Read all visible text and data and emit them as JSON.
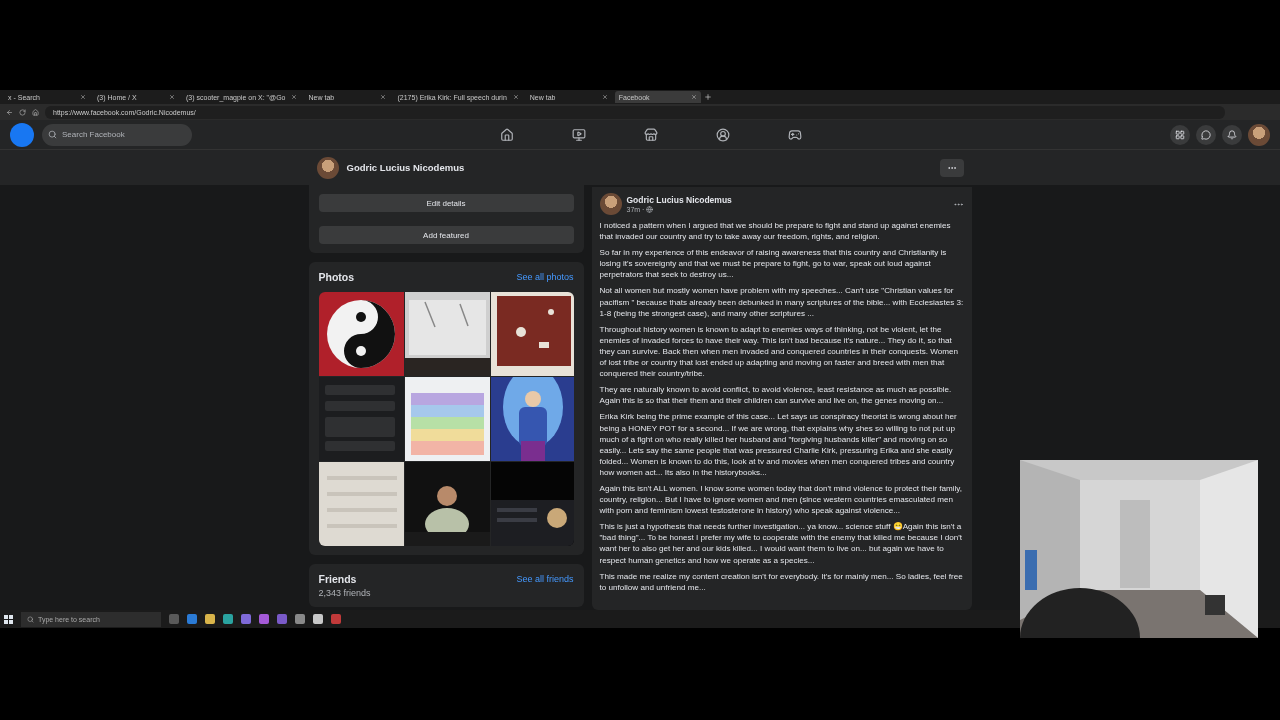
{
  "browser": {
    "tabs": [
      {
        "title": "x - Search",
        "selected": false
      },
      {
        "title": "(3) Home / X",
        "selected": false
      },
      {
        "title": "(3) scooter_magpie on X: \"@Go",
        "selected": false
      },
      {
        "title": "New tab",
        "selected": false
      },
      {
        "title": "(2175) Erika Kirk: Full speech durin",
        "selected": false
      },
      {
        "title": "New tab",
        "selected": false
      },
      {
        "title": "Facebook",
        "selected": true
      }
    ],
    "url": "https://www.facebook.com/Godric.Nicodemus/"
  },
  "header": {
    "search_placeholder": "Search Facebook"
  },
  "profile_bar": {
    "name": "Godric Lucius Nicodemus"
  },
  "intro": {
    "buttons": [
      "Edit details",
      "Add featured"
    ]
  },
  "photos": {
    "title": "Photos",
    "link": "See all photos"
  },
  "friends": {
    "title": "Friends",
    "link": "See all friends",
    "count": "2,343 friends"
  },
  "post": {
    "author": "Godric Lucius Nicodemus",
    "time": "37m ·",
    "paragraphs": [
      "I noticed a pattern when I argued that we should be prepare to fight and stand up against enemies that invaded our country and try to take away our freedom, rights, and religion.",
      "So far in my experience of this endeavor of raising awareness that this country and Christianity is losing it's sovereignty and that we must be prepare to fight, go to war, speak out loud against perpetrators that seek to destroy us...",
      "Not all women but mostly women have problem with my speeches... Can't use \"Christian values for pacifism \" because thats already been debunked in many scriptures of the bible... with Ecclesiastes 3: 1-8 (being the strongest case), and many other scriptures ...",
      "Throughout history women is known to adapt to enemies ways of thinking, not be violent, let the enemies of invaded forces to have their way. This isn't bad because it's nature... They do it, so that they can survive. Back then when men invaded and conquered countries in their conquests. Women of  lost tribe or country that lost ended up adapting and moving on faster and breed with men that conquered their country/tribe.",
      "They are naturally known to avoid conflict, to avoid violence, least resistance as much as possible. Again this is so that their them and their children can survive and live on, the genes moving on...",
      "Erika Kirk being the prime example of this case... Let says us conspiracy theorist is wrong about her being a HONEY POT for a second... If we are wrong, that explains why shes so willing to not put up much of a fight on who really killed her husband and \"forgiving husbands killer\" and moving on so easily... Lets say the same people that was pressured Charlie Kirk, pressuring Erika and she easily folded... Women is known to do this, look at tv and movies when men conquered tribes and country how women act... Its also in the historybooks...",
      "Again this isn't ALL women. I know some women today that don't mind violence to protect their family, country, religion... But I have to ignore women and men (since western countries emasculated men with porn and feminism lowest testosterone in history) who speak against violence...",
      "This is just a hypothesis that needs further investigation... ya know... science stuff 😁Again this isn't a \"bad thing\"... To be honest I prefer my wife to cooperate with the enemy that killed me because I don't want her to also get her and our kids killed... I would want them to live on... but again we have to respect human genetics and how we operate as a species...",
      "This made me realize my content creation isn't for everybody. It's for mainly men... So ladies, feel free to unfollow and unfriend me..."
    ]
  },
  "taskbar": {
    "search_placeholder": "Type here to search"
  }
}
